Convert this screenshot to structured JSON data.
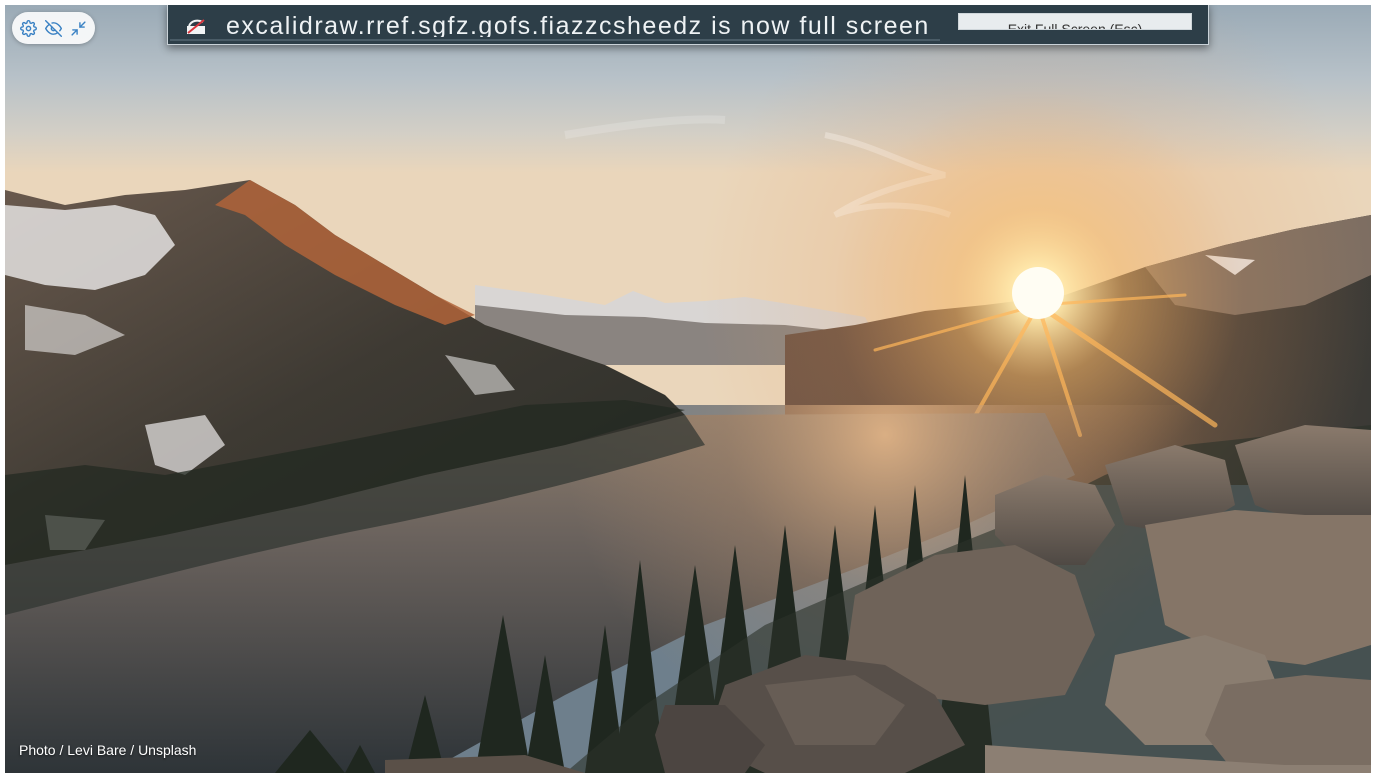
{
  "toolbar": {
    "buttons": [
      {
        "icon": "gear-icon",
        "color": "#3b82c4"
      },
      {
        "icon": "eye-off-icon",
        "color": "#3b82c4"
      },
      {
        "icon": "exit-fullscreen-icon",
        "color": "#3b82c4"
      }
    ]
  },
  "fullscreen_banner": {
    "message": "excalidraw.rref.sgfz.gofs.fiazzcsheedz is now full screen",
    "exit_label": "Exit Full Screen (Esc)"
  },
  "photo": {
    "credit": "Photo / Levi Bare / Unsplash"
  },
  "colors": {
    "accent": "#3b82c4",
    "banner_bg": "#2d3e48"
  }
}
